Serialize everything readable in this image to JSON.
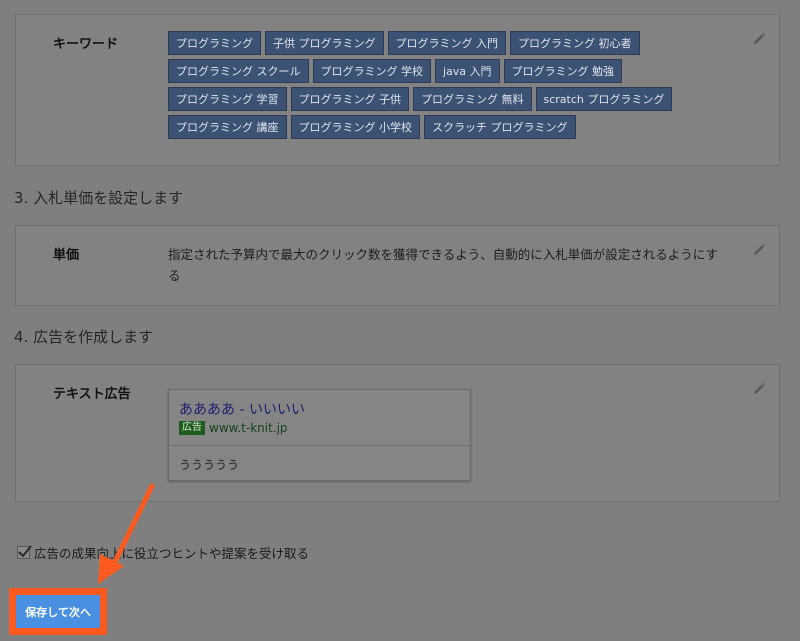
{
  "keywords_card": {
    "label": "キーワード",
    "chips": [
      "プログラミング",
      "子供 プログラミング",
      "プログラミング 入門",
      "プログラミング 初心者",
      "プログラミング スクール",
      "プログラミング 学校",
      "java 入門",
      "プログラミング 勉強",
      "プログラミング 学習",
      "プログラミング 子供",
      "プログラミング 無料",
      "scratch プログラミング",
      "プログラミング 講座",
      "プログラミング 小学校",
      "スクラッチ プログラミング"
    ]
  },
  "step3": {
    "heading": "3. 入札単価を設定します"
  },
  "bid_card": {
    "label": "単価",
    "text": "指定された予算内で最大のクリック数を獲得できるよう、自動的に入札単価が設定されるようにする"
  },
  "step4": {
    "heading": "4. 広告を作成します"
  },
  "ad_card": {
    "label": "テキスト広告",
    "headline": "ああああ - いいいい",
    "badge": "広告",
    "url": "www.t-knit.jp",
    "description": "ううううう"
  },
  "opt_in": {
    "label": "広告の成果向上に役立つヒントや提案を受け取る",
    "checked": true
  },
  "save_button": {
    "label": "保存して次へ"
  },
  "colors": {
    "accent": "#4a90e2",
    "highlight": "#ff5a1f",
    "chip": "#3c5274"
  },
  "icons": {
    "edit": "pencil-icon",
    "check": "check-icon",
    "arrow": "arrow-icon"
  }
}
